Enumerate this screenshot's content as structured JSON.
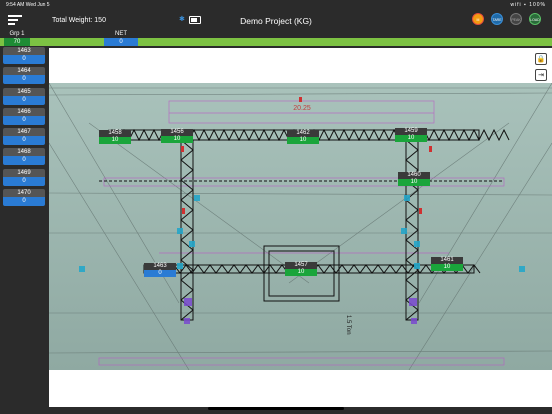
{
  "status": {
    "time": "9:54 AM  Wed Jun 5",
    "icons": "wifi ▪ 100%"
  },
  "header": {
    "total_weight": "Total Weight: 150",
    "project_title": "Demo Project (KG)",
    "bluetooth_icon": "bluetooth-icon",
    "battery_icon": "battery-icon",
    "circle_buttons": [
      {
        "label": "M",
        "color": "#f39c12",
        "border": "#e74c3c",
        "text": "#ffffff"
      },
      {
        "label": "TARE",
        "color": "#1f6aa8",
        "border": "#3a8fd9",
        "text": "#ffffff"
      },
      {
        "label": "PEAK",
        "color": "#444444",
        "border": "#777777",
        "text": "#aaaaaa"
      },
      {
        "label": "LOAD",
        "color": "#2a6b3a",
        "border": "#5abf66",
        "text": "#ffffff"
      }
    ]
  },
  "group": {
    "label": "Grp 1",
    "value": "70",
    "net_label": "NET",
    "net_value": "0",
    "bar_color": "#7dc243"
  },
  "sidebar": {
    "items": [
      {
        "id": "1463",
        "value": "0"
      },
      {
        "id": "1464",
        "value": "0"
      },
      {
        "id": "1465",
        "value": "0"
      },
      {
        "id": "1466",
        "value": "0"
      },
      {
        "id": "1467",
        "value": "0"
      },
      {
        "id": "1468",
        "value": "0"
      },
      {
        "id": "1469",
        "value": "0"
      },
      {
        "id": "1470",
        "value": "0"
      }
    ]
  },
  "canvas": {
    "lock_icon": "lock-icon",
    "exit_icon": "exit-icon",
    "markers": [
      {
        "id": "1458",
        "value": "10",
        "status": "green"
      },
      {
        "id": "1456",
        "value": "10",
        "status": "green"
      },
      {
        "id": "1462",
        "value": "10",
        "status": "green"
      },
      {
        "id": "1459",
        "value": "10",
        "status": "green"
      },
      {
        "id": "1460",
        "value": "10",
        "status": "green"
      },
      {
        "id": "1463",
        "value": "0",
        "status": "blue"
      },
      {
        "id": "1457",
        "value": "10",
        "status": "green"
      },
      {
        "id": "1461",
        "value": "10",
        "status": "green"
      }
    ]
  }
}
